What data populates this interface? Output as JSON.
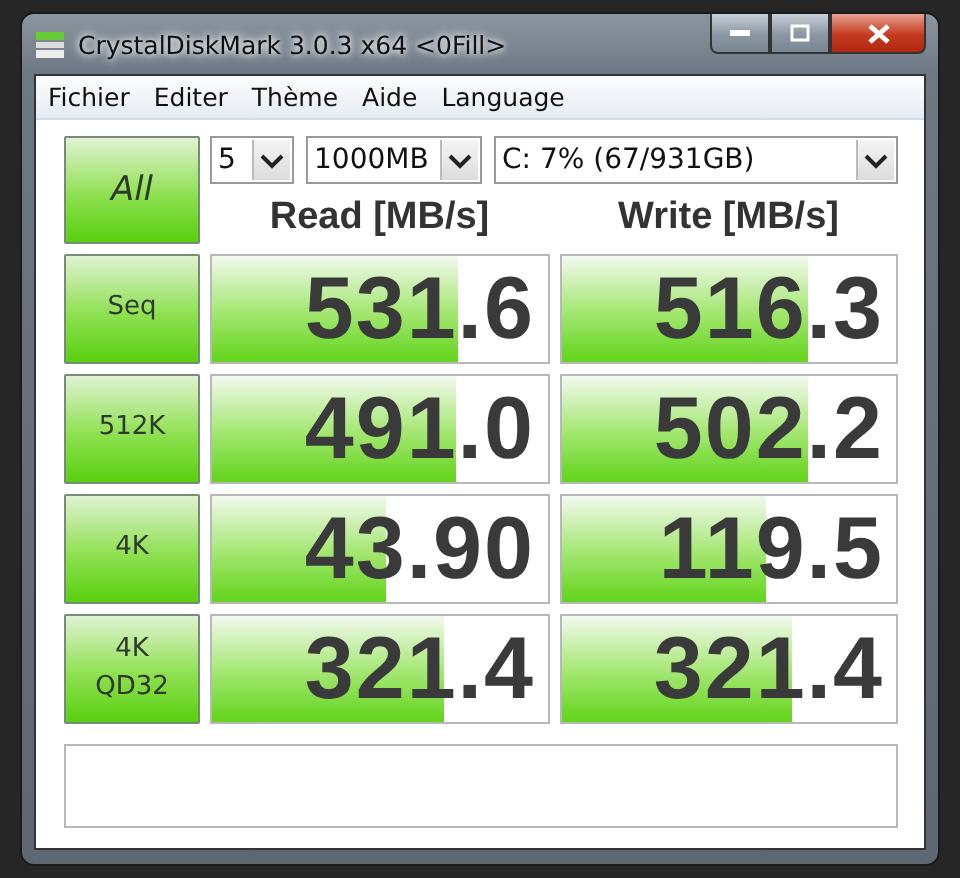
{
  "window": {
    "title": "CrystalDiskMark 3.0.3 x64 <0Fill>"
  },
  "menu": [
    "Fichier",
    "Editer",
    "Thème",
    "Aide",
    "Language"
  ],
  "all_button": "All",
  "selectors": [
    "5",
    "1000MB",
    "C: 7% (67/931GB)"
  ],
  "columns": [
    "Read [MB/s]",
    "Write [MB/s]"
  ],
  "rows": [
    {
      "label": "Seq",
      "read": {
        "value": "531.6",
        "level": 0.735
      },
      "write": {
        "value": "516.3",
        "level": 0.735
      }
    },
    {
      "label": "512K",
      "read": {
        "value": "491.0",
        "level": 0.73
      },
      "write": {
        "value": "502.2",
        "level": 0.735
      }
    },
    {
      "label": "4K",
      "read": {
        "value": "43.90",
        "level": 0.52
      },
      "write": {
        "value": "119.5",
        "level": 0.61
      }
    },
    {
      "label": "4K\nQD32",
      "read": {
        "value": "321.4",
        "level": 0.69
      },
      "write": {
        "value": "321.4",
        "level": 0.69
      }
    }
  ]
}
